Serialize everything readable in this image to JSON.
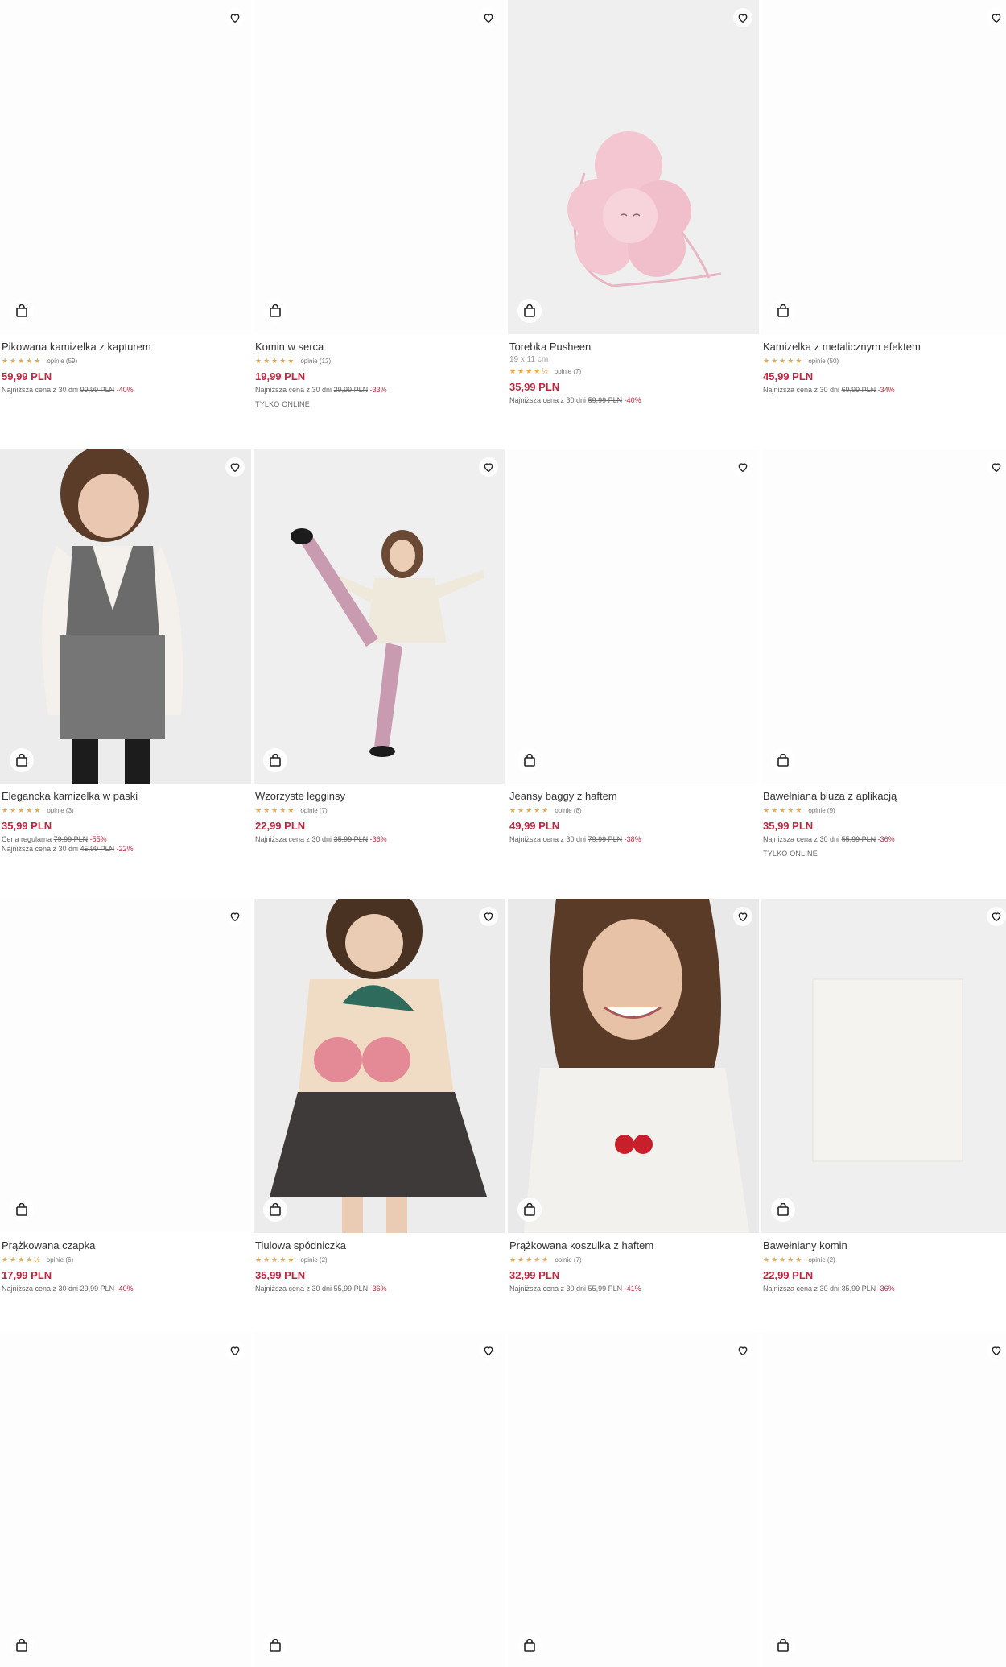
{
  "products": [
    {
      "name": "Pikowana kamizelka z kapturem",
      "rating_stars": "★★★★★",
      "reviews": "opinie (59)",
      "price": "59,99 PLN",
      "lowest_label": "Najniższa cena z 30 dni",
      "lowest_old": "99,99 PLN",
      "lowest_disc": "-40%"
    },
    {
      "name": "Komin w serca",
      "rating_stars": "★★★★★",
      "reviews": "opinie (12)",
      "price": "19,99 PLN",
      "lowest_label": "Najniższa cena z 30 dni",
      "lowest_old": "29,99 PLN",
      "lowest_disc": "-33%",
      "badge": "TYLKO ONLINE"
    },
    {
      "name": "Torebka Pusheen",
      "subtitle": "19 x 11 cm",
      "rating_stars": "★★★★½",
      "reviews": "opinie (7)",
      "price": "35,99 PLN",
      "lowest_label": "Najniższa cena z 30 dni",
      "lowest_old": "59,99 PLN",
      "lowest_disc": "-40%"
    },
    {
      "name": "Kamizelka z metalicznym efektem",
      "rating_stars": "★★★★★",
      "reviews": "opinie (50)",
      "price": "45,99 PLN",
      "lowest_label": "Najniższa cena z 30 dni",
      "lowest_old": "69,99 PLN",
      "lowest_disc": "-34%"
    },
    {
      "name": "Elegancka kamizelka w paski",
      "rating_stars": "★★★★★",
      "reviews": "opinie (3)",
      "price": "35,99 PLN",
      "regular_label": "Cena regularna",
      "regular_old": "79,99 PLN",
      "regular_disc": "-55%",
      "lowest_label": "Najniższa cena z 30 dni",
      "lowest_old": "45,99 PLN",
      "lowest_disc": "-22%"
    },
    {
      "name": "Wzorzyste legginsy",
      "rating_stars": "★★★★★",
      "reviews": "opinie (7)",
      "price": "22,99 PLN",
      "lowest_label": "Najniższa cena z 30 dni",
      "lowest_old": "35,99 PLN",
      "lowest_disc": "-36%"
    },
    {
      "name": "Jeansy baggy z haftem",
      "rating_stars": "★★★★★",
      "reviews": "opinie (8)",
      "price": "49,99 PLN",
      "lowest_label": "Najniższa cena z 30 dni",
      "lowest_old": "79,99 PLN",
      "lowest_disc": "-38%"
    },
    {
      "name": "Bawełniana bluza z aplikacją",
      "rating_stars": "★★★★★",
      "reviews": "opinie (9)",
      "price": "35,99 PLN",
      "lowest_label": "Najniższa cena z 30 dni",
      "lowest_old": "55,99 PLN",
      "lowest_disc": "-36%",
      "badge": "TYLKO ONLINE"
    },
    {
      "name": "Prążkowana czapka",
      "rating_stars": "★★★★½",
      "reviews": "opinie (6)",
      "price": "17,99 PLN",
      "lowest_label": "Najniższa cena z 30 dni",
      "lowest_old": "29,99 PLN",
      "lowest_disc": "-40%"
    },
    {
      "name": "Tiulowa spódniczka",
      "rating_stars": "★★★★★",
      "reviews": "opinie (2)",
      "price": "35,99 PLN",
      "lowest_label": "Najniższa cena z 30 dni",
      "lowest_old": "55,99 PLN",
      "lowest_disc": "-36%"
    },
    {
      "name": "Prążkowana koszulka z haftem",
      "rating_stars": "★★★★★",
      "reviews": "opinie (7)",
      "price": "32,99 PLN",
      "lowest_label": "Najniższa cena z 30 dni",
      "lowest_old": "55,99 PLN",
      "lowest_disc": "-41%"
    },
    {
      "name": "Bawełniany komin",
      "rating_stars": "★★★★★",
      "reviews": "opinie (2)",
      "price": "22,99 PLN",
      "lowest_label": "Najniższa cena z 30 dni",
      "lowest_old": "35,99 PLN",
      "lowest_disc": "-36%"
    }
  ],
  "icons": {
    "wishlist": "heart-icon",
    "cart": "shopping-bag-icon"
  },
  "colors": {
    "price": "#c2263f",
    "stars": "#f0a640"
  }
}
